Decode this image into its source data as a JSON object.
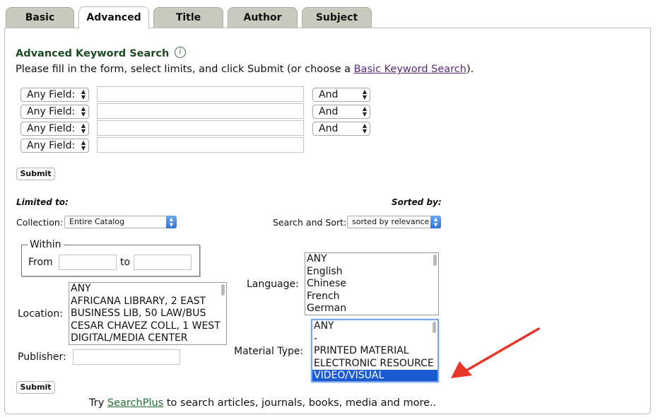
{
  "tabs": [
    {
      "label": "Basic",
      "active": false
    },
    {
      "label": "Advanced",
      "active": true
    },
    {
      "label": "Title",
      "active": false
    },
    {
      "label": "Author",
      "active": false
    },
    {
      "label": "Subject",
      "active": false
    }
  ],
  "heading": "Advanced Keyword Search",
  "instructions": {
    "before": "Please fill in the form, select limits, and click Submit (or choose a ",
    "link": "Basic Keyword Search",
    "after": ")."
  },
  "search_rows": [
    {
      "field": "Any Field:",
      "operator": "And"
    },
    {
      "field": "Any Field:",
      "operator": "And"
    },
    {
      "field": "Any Field:",
      "operator": "And"
    },
    {
      "field": "Any Field:",
      "operator": null
    }
  ],
  "submit_label": "Submit",
  "limited_to_label": "Limited to:",
  "sorted_by_label": "Sorted by:",
  "collection": {
    "label": "Collection:",
    "value": "Entire Catalog"
  },
  "search_and_sort": {
    "label": "Search and Sort:",
    "value": "sorted by relevance"
  },
  "within": {
    "legend": "Within",
    "from_label": "From",
    "to_label": "to"
  },
  "language": {
    "label": "Language:",
    "options": [
      "ANY",
      "English",
      "Chinese",
      "French",
      "German"
    ]
  },
  "location": {
    "label": "Location:",
    "options": [
      "ANY",
      "AFRICANA LIBRARY, 2 EAST",
      "BUSINESS LIB, 50 LAW/BUS",
      "CESAR CHAVEZ COLL, 1 WEST",
      "DIGITAL/MEDIA CENTER"
    ]
  },
  "material_type": {
    "label": "Material Type:",
    "options": [
      "ANY",
      "-",
      "PRINTED MATERIAL",
      "ELECTRONIC RESOURCE",
      "VIDEO/VISUAL"
    ],
    "selected": "VIDEO/VISUAL"
  },
  "publisher_label": "Publisher:",
  "footer": {
    "before": "Try ",
    "link": "SearchPlus",
    "after": " to search articles, journals, books, media and more.."
  },
  "colors": {
    "tab_bg": "#c7cbbd",
    "heading": "#1e4a22",
    "selected_option": "#1a5bd1",
    "annotation_arrow": "#e8362b"
  }
}
